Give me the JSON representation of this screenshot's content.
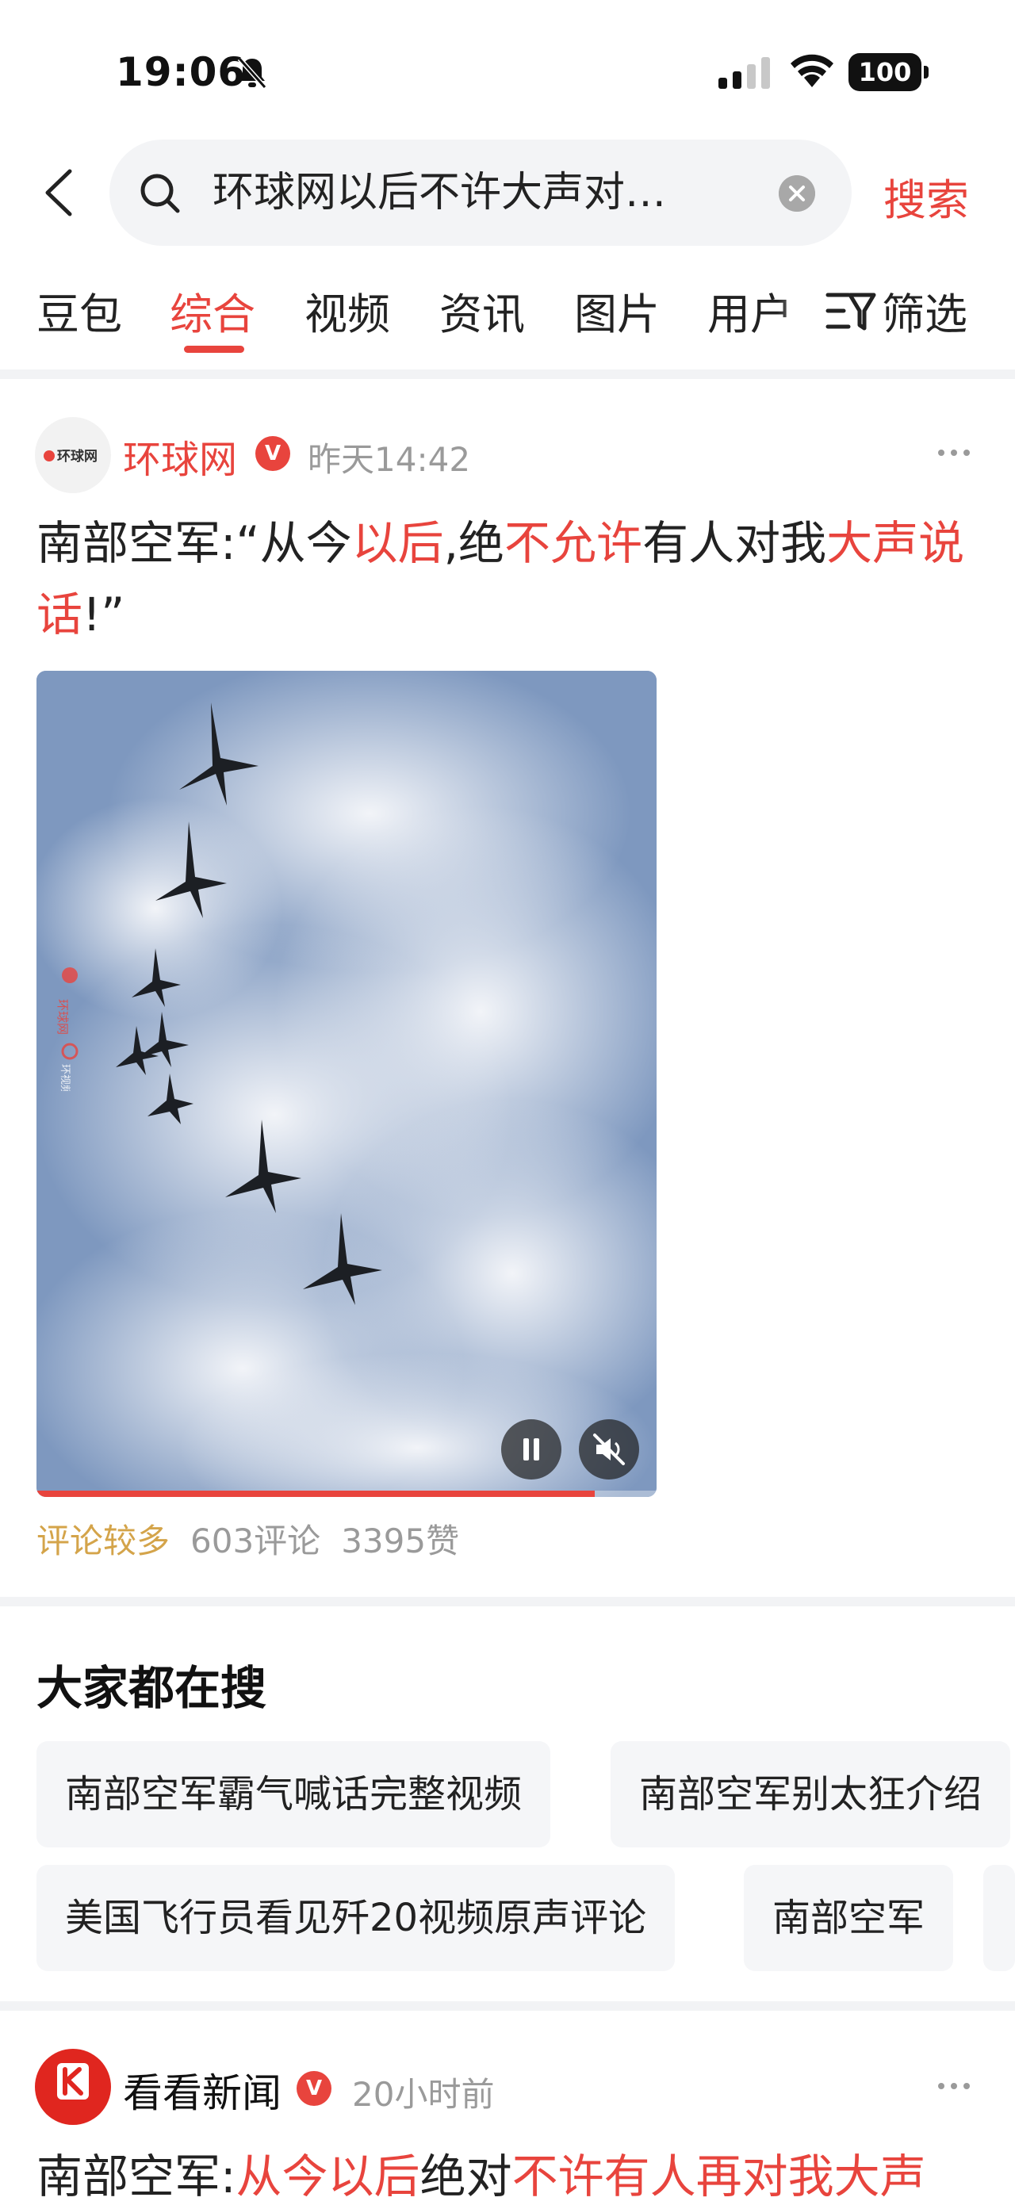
{
  "status_bar": {
    "time": "19:06",
    "battery": "100"
  },
  "search": {
    "query": "环球网以后不许大声对…",
    "button": "搜索"
  },
  "tabs": [
    {
      "label": "豆包"
    },
    {
      "label": "综合",
      "active": true
    },
    {
      "label": "视频"
    },
    {
      "label": "资讯"
    },
    {
      "label": "图片"
    },
    {
      "label": "用户"
    }
  ],
  "filter_label": "筛选",
  "article1": {
    "source": "环球网",
    "verified_mark": "V",
    "time": "昨天14:42",
    "avatar_logo": "环球网",
    "headline_parts": [
      {
        "text": "南部空军:“从今"
      },
      {
        "text": "以后",
        "hl": true
      },
      {
        "text": ",绝"
      },
      {
        "text": "不允许",
        "hl": true
      },
      {
        "text": "有人对我"
      },
      {
        "text": "大声",
        "hl": true
      },
      {
        "text": "说话",
        "hl": true
      },
      {
        "text": "!”"
      }
    ],
    "video": {
      "watermark": "环球网",
      "watermark2": "环视频",
      "progress": 0.9
    },
    "meta": {
      "tag": "评论较多",
      "comments": "603评论",
      "likes": "3395赞"
    }
  },
  "trending": {
    "title": "大家都在搜",
    "items": [
      "南部空军霸气喊话完整视频",
      "南部空军别太狂介绍",
      "美国飞行员看见歼20视频原声评论",
      "南部空军"
    ]
  },
  "article2": {
    "source": "看看新闻",
    "verified_mark": "V",
    "time": "20小时前",
    "headline_parts": [
      {
        "text": "南部空军:"
      },
      {
        "text": "从今以后",
        "hl": true
      },
      {
        "text": "绝对"
      },
      {
        "text": "不许有人再对我大声",
        "hl": true
      }
    ]
  },
  "colors": {
    "accent": "#e8443d",
    "hot_tag": "#d4a44a",
    "muted": "#9a9a9a"
  }
}
